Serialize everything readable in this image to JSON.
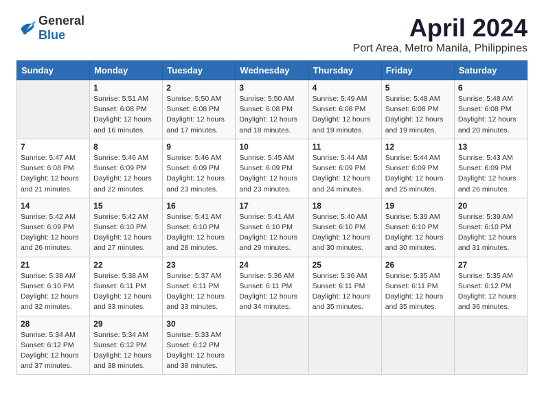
{
  "header": {
    "logo_general": "General",
    "logo_blue": "Blue",
    "title": "April 2024",
    "subtitle": "Port Area, Metro Manila, Philippines"
  },
  "calendar": {
    "days_of_week": [
      "Sunday",
      "Monday",
      "Tuesday",
      "Wednesday",
      "Thursday",
      "Friday",
      "Saturday"
    ],
    "weeks": [
      [
        {
          "day": "",
          "info": ""
        },
        {
          "day": "1",
          "info": "Sunrise: 5:51 AM\nSunset: 6:08 PM\nDaylight: 12 hours\nand 16 minutes."
        },
        {
          "day": "2",
          "info": "Sunrise: 5:50 AM\nSunset: 6:08 PM\nDaylight: 12 hours\nand 17 minutes."
        },
        {
          "day": "3",
          "info": "Sunrise: 5:50 AM\nSunset: 6:08 PM\nDaylight: 12 hours\nand 18 minutes."
        },
        {
          "day": "4",
          "info": "Sunrise: 5:49 AM\nSunset: 6:08 PM\nDaylight: 12 hours\nand 19 minutes."
        },
        {
          "day": "5",
          "info": "Sunrise: 5:48 AM\nSunset: 6:08 PM\nDaylight: 12 hours\nand 19 minutes."
        },
        {
          "day": "6",
          "info": "Sunrise: 5:48 AM\nSunset: 6:08 PM\nDaylight: 12 hours\nand 20 minutes."
        }
      ],
      [
        {
          "day": "7",
          "info": "Sunrise: 5:47 AM\nSunset: 6:08 PM\nDaylight: 12 hours\nand 21 minutes."
        },
        {
          "day": "8",
          "info": "Sunrise: 5:46 AM\nSunset: 6:09 PM\nDaylight: 12 hours\nand 22 minutes."
        },
        {
          "day": "9",
          "info": "Sunrise: 5:46 AM\nSunset: 6:09 PM\nDaylight: 12 hours\nand 23 minutes."
        },
        {
          "day": "10",
          "info": "Sunrise: 5:45 AM\nSunset: 6:09 PM\nDaylight: 12 hours\nand 23 minutes."
        },
        {
          "day": "11",
          "info": "Sunrise: 5:44 AM\nSunset: 6:09 PM\nDaylight: 12 hours\nand 24 minutes."
        },
        {
          "day": "12",
          "info": "Sunrise: 5:44 AM\nSunset: 6:09 PM\nDaylight: 12 hours\nand 25 minutes."
        },
        {
          "day": "13",
          "info": "Sunrise: 5:43 AM\nSunset: 6:09 PM\nDaylight: 12 hours\nand 26 minutes."
        }
      ],
      [
        {
          "day": "14",
          "info": "Sunrise: 5:42 AM\nSunset: 6:09 PM\nDaylight: 12 hours\nand 26 minutes."
        },
        {
          "day": "15",
          "info": "Sunrise: 5:42 AM\nSunset: 6:10 PM\nDaylight: 12 hours\nand 27 minutes."
        },
        {
          "day": "16",
          "info": "Sunrise: 5:41 AM\nSunset: 6:10 PM\nDaylight: 12 hours\nand 28 minutes."
        },
        {
          "day": "17",
          "info": "Sunrise: 5:41 AM\nSunset: 6:10 PM\nDaylight: 12 hours\nand 29 minutes."
        },
        {
          "day": "18",
          "info": "Sunrise: 5:40 AM\nSunset: 6:10 PM\nDaylight: 12 hours\nand 30 minutes."
        },
        {
          "day": "19",
          "info": "Sunrise: 5:39 AM\nSunset: 6:10 PM\nDaylight: 12 hours\nand 30 minutes."
        },
        {
          "day": "20",
          "info": "Sunrise: 5:39 AM\nSunset: 6:10 PM\nDaylight: 12 hours\nand 31 minutes."
        }
      ],
      [
        {
          "day": "21",
          "info": "Sunrise: 5:38 AM\nSunset: 6:10 PM\nDaylight: 12 hours\nand 32 minutes."
        },
        {
          "day": "22",
          "info": "Sunrise: 5:38 AM\nSunset: 6:11 PM\nDaylight: 12 hours\nand 33 minutes."
        },
        {
          "day": "23",
          "info": "Sunrise: 5:37 AM\nSunset: 6:11 PM\nDaylight: 12 hours\nand 33 minutes."
        },
        {
          "day": "24",
          "info": "Sunrise: 5:36 AM\nSunset: 6:11 PM\nDaylight: 12 hours\nand 34 minutes."
        },
        {
          "day": "25",
          "info": "Sunrise: 5:36 AM\nSunset: 6:11 PM\nDaylight: 12 hours\nand 35 minutes."
        },
        {
          "day": "26",
          "info": "Sunrise: 5:35 AM\nSunset: 6:11 PM\nDaylight: 12 hours\nand 35 minutes."
        },
        {
          "day": "27",
          "info": "Sunrise: 5:35 AM\nSunset: 6:12 PM\nDaylight: 12 hours\nand 36 minutes."
        }
      ],
      [
        {
          "day": "28",
          "info": "Sunrise: 5:34 AM\nSunset: 6:12 PM\nDaylight: 12 hours\nand 37 minutes."
        },
        {
          "day": "29",
          "info": "Sunrise: 5:34 AM\nSunset: 6:12 PM\nDaylight: 12 hours\nand 38 minutes."
        },
        {
          "day": "30",
          "info": "Sunrise: 5:33 AM\nSunset: 6:12 PM\nDaylight: 12 hours\nand 38 minutes."
        },
        {
          "day": "",
          "info": ""
        },
        {
          "day": "",
          "info": ""
        },
        {
          "day": "",
          "info": ""
        },
        {
          "day": "",
          "info": ""
        }
      ]
    ]
  }
}
